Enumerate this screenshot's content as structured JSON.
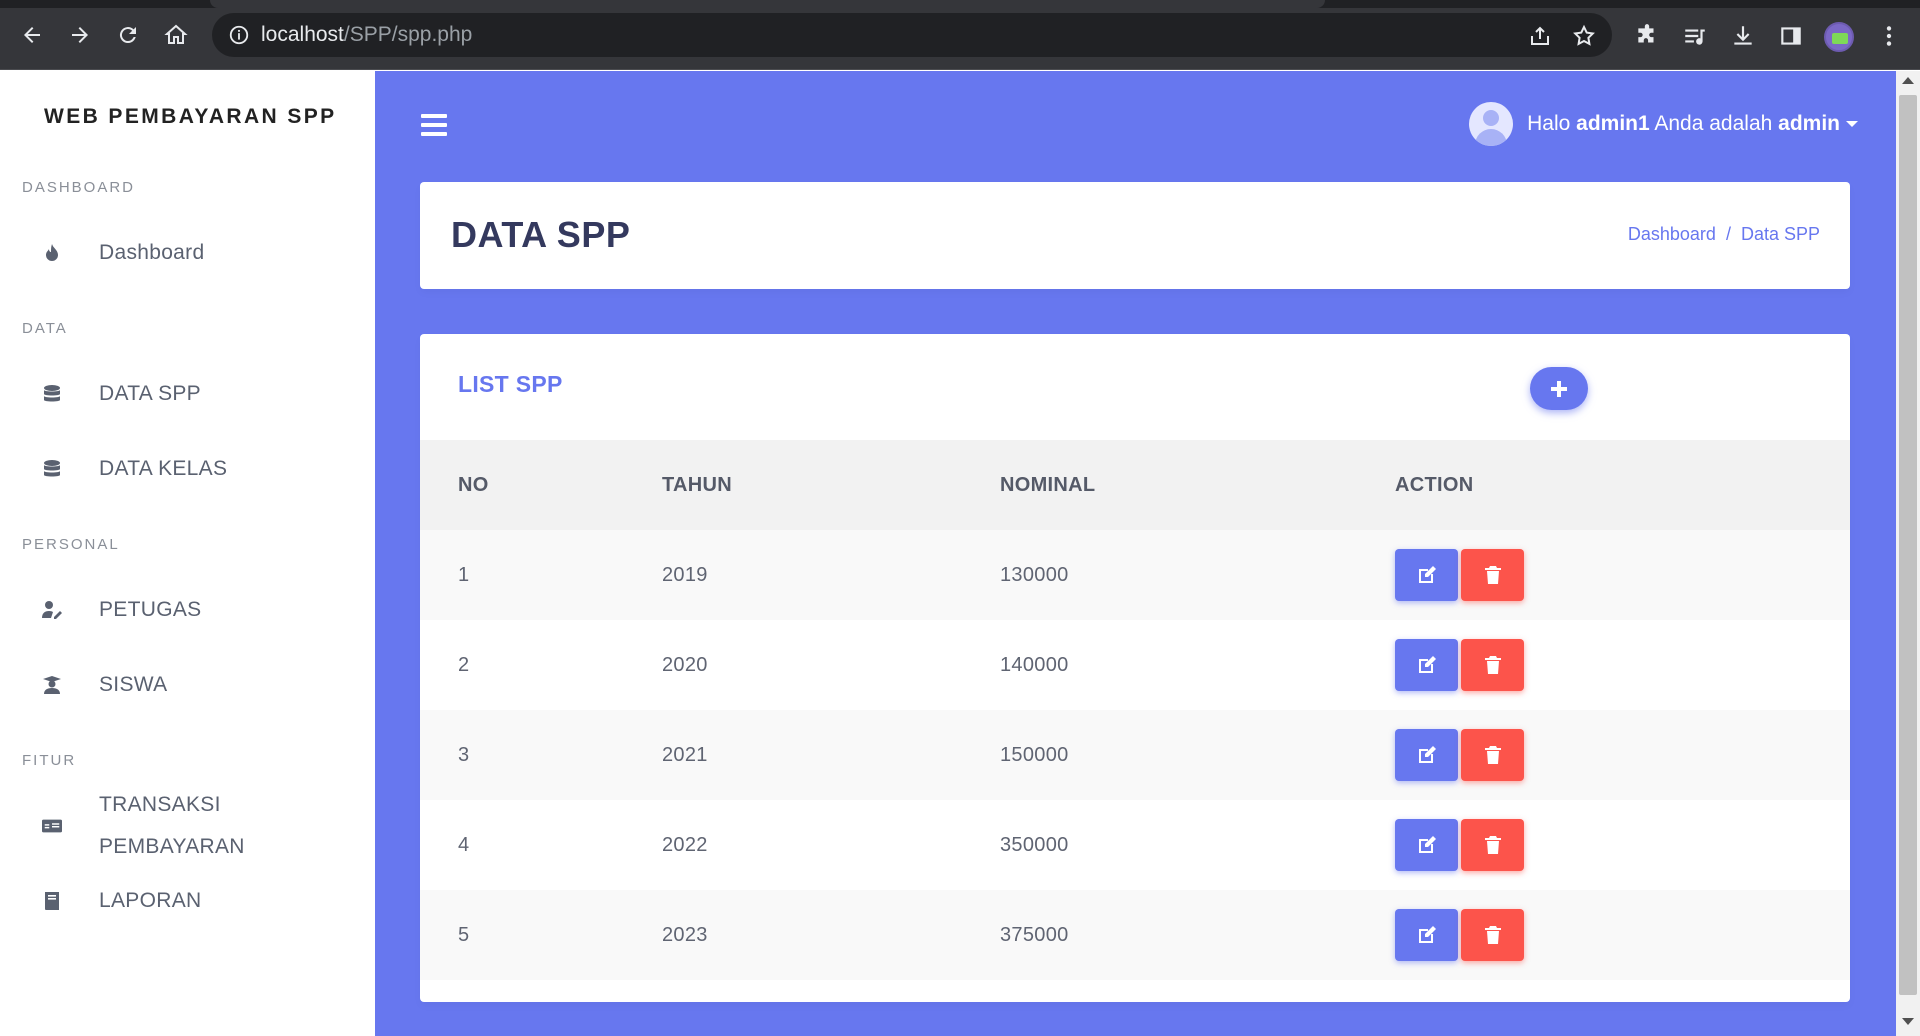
{
  "browser": {
    "url_host": "localhost",
    "url_path": "/SPP/spp.php",
    "icons": [
      "back-icon",
      "forward-icon",
      "reload-icon",
      "home-icon",
      "info-icon",
      "share-icon",
      "star-icon",
      "extensions-icon",
      "media-icon",
      "download-icon",
      "sidepanel-icon",
      "profile-avatar",
      "menu-icon"
    ]
  },
  "sidebar": {
    "brand": "WEB PEMBAYARAN SPP",
    "sections": [
      {
        "heading": "DASHBOARD",
        "items": [
          {
            "label": "Dashboard",
            "icon": "fire-icon"
          }
        ]
      },
      {
        "heading": "DATA",
        "items": [
          {
            "label": "DATA SPP",
            "icon": "database-icon"
          },
          {
            "label": "DATA KELAS",
            "icon": "database-icon"
          }
        ]
      },
      {
        "heading": "PERSONAL",
        "items": [
          {
            "label": "PETUGAS",
            "icon": "user-edit-icon"
          },
          {
            "label": "SISWA",
            "icon": "graduate-icon"
          }
        ]
      },
      {
        "heading": "FITUR",
        "items": [
          {
            "label_line1": "TRANSAKSI",
            "label_line2": "PEMBAYARAN",
            "icon": "money-check-icon"
          },
          {
            "label": "LAPORAN",
            "icon": "book-icon"
          }
        ]
      }
    ]
  },
  "topbar": {
    "greeting": "Halo",
    "username": "admin1",
    "role_prefix": "Anda adalah",
    "role": "admin"
  },
  "header": {
    "title": "DATA SPP",
    "breadcrumb": [
      "Dashboard",
      "Data SPP"
    ]
  },
  "list": {
    "title": "LIST SPP",
    "columns": [
      "NO",
      "TAHUN",
      "NOMINAL",
      "ACTION"
    ],
    "rows": [
      {
        "no": "1",
        "tahun": "2019",
        "nominal": "130000"
      },
      {
        "no": "2",
        "tahun": "2020",
        "nominal": "140000"
      },
      {
        "no": "3",
        "tahun": "2021",
        "nominal": "150000"
      },
      {
        "no": "4",
        "tahun": "2022",
        "nominal": "350000"
      },
      {
        "no": "5",
        "tahun": "2023",
        "nominal": "375000"
      }
    ]
  },
  "colors": {
    "primary": "#6777ef",
    "danger": "#fc544b",
    "sidebar_bg": "#ffffff",
    "chrome_bg": "#35363a"
  }
}
